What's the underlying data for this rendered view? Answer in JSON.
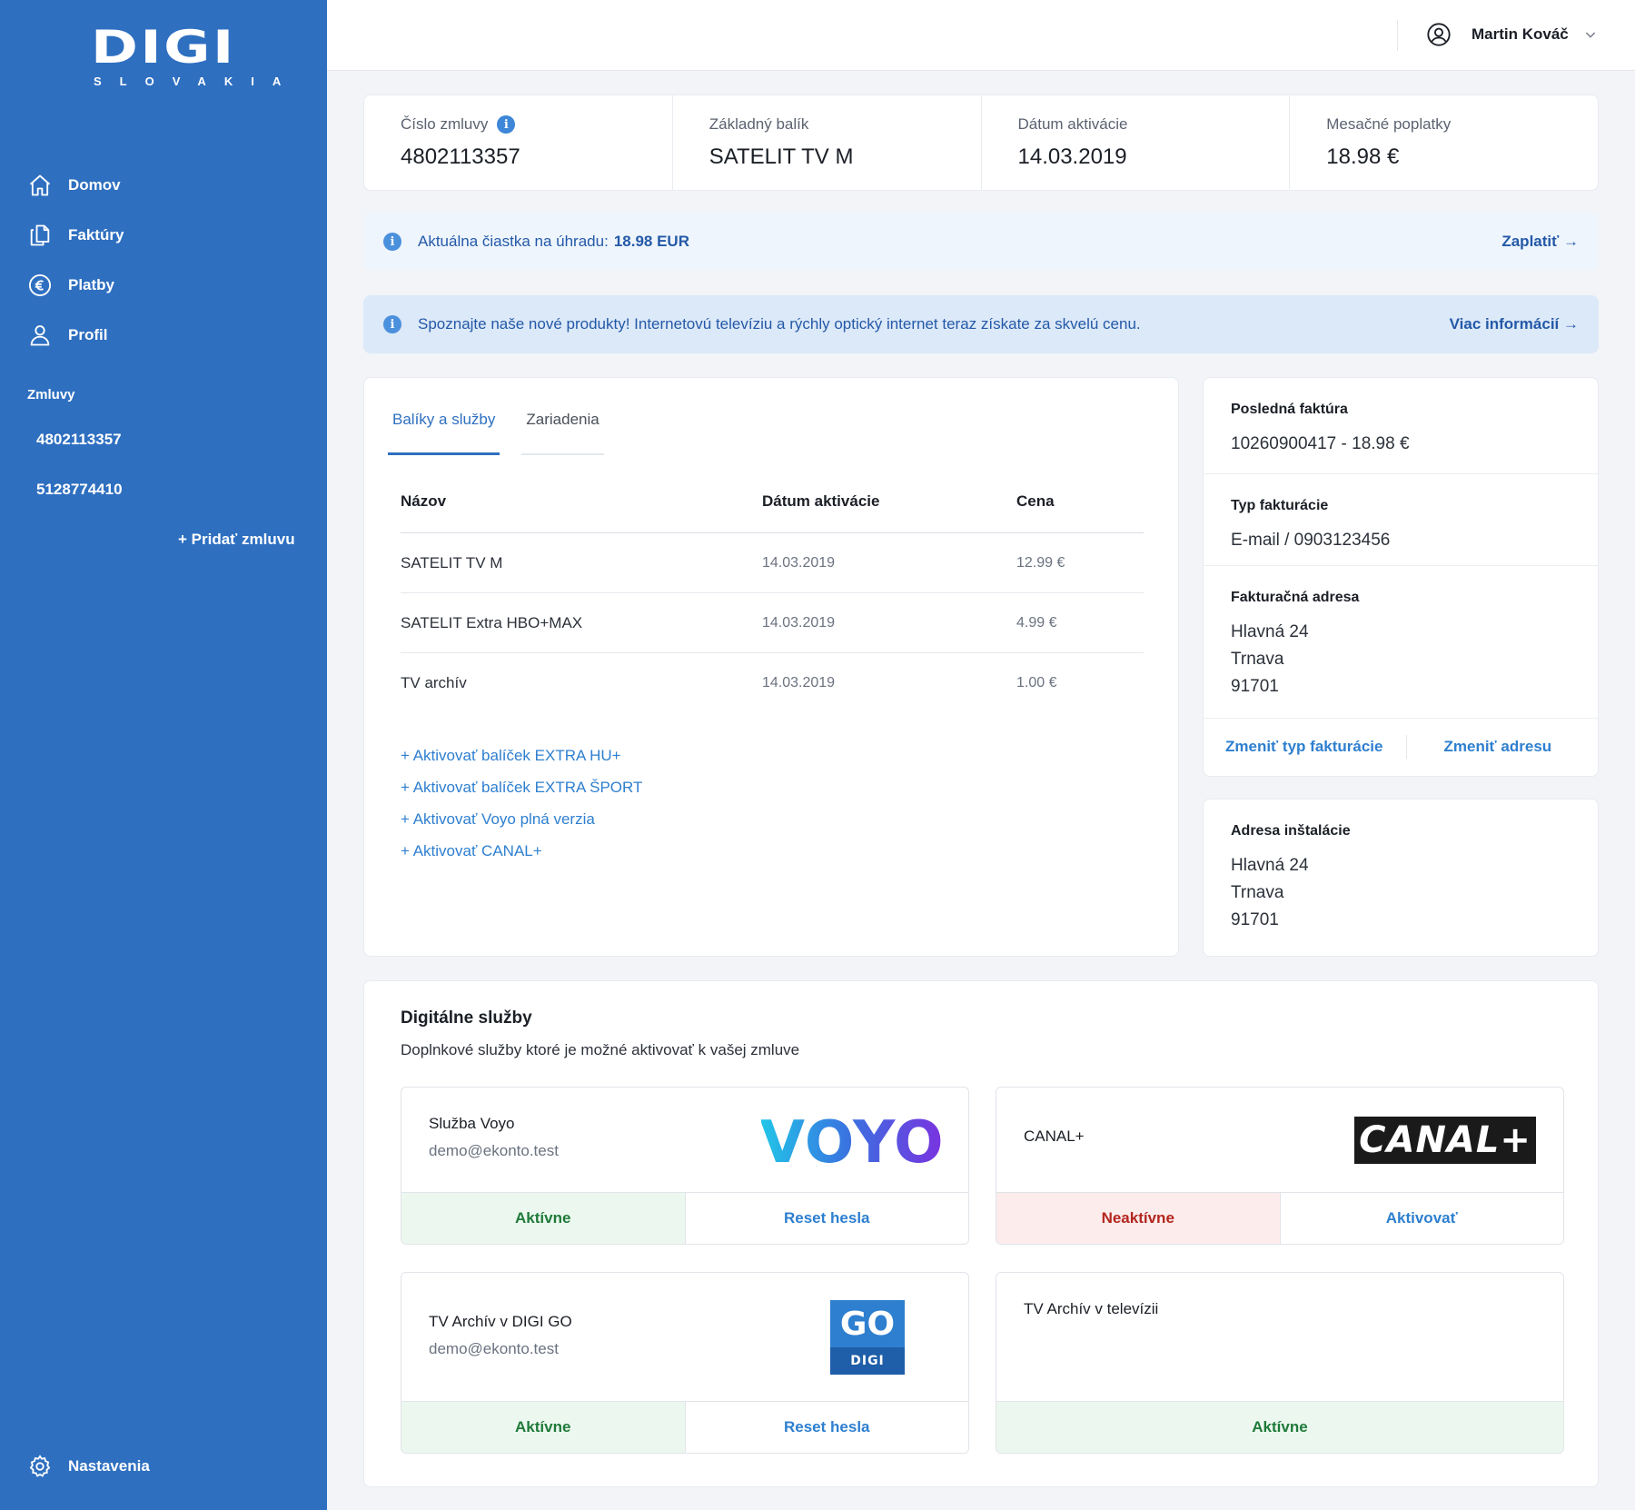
{
  "brand": {
    "logo_main": "DIGI",
    "logo_sub": "SLOVAKIA",
    "color": "#2e6fc0"
  },
  "sidebar": {
    "nav": [
      {
        "label": "Domov",
        "icon": "home-icon"
      },
      {
        "label": "Faktúry",
        "icon": "documents-icon"
      },
      {
        "label": "Platby",
        "icon": "euro-icon"
      },
      {
        "label": "Profil",
        "icon": "user-icon"
      }
    ],
    "contracts_label": "Zmluvy",
    "contracts": [
      "4802113357",
      "5128774410"
    ],
    "add_contract": "+ Pridať zmluvu",
    "settings": "Nastavenia"
  },
  "header": {
    "user_name": "Martin Kováč"
  },
  "summary": [
    {
      "label": "Číslo zmluvy",
      "value": "4802113357"
    },
    {
      "label": "Základný balík",
      "value": "SATELIT TV M"
    },
    {
      "label": "Dátum aktivácie",
      "value": "14.03.2019"
    },
    {
      "label": "Mesačné poplatky",
      "value": "18.98 €"
    }
  ],
  "alerts": {
    "payment_text": "Aktuálna čiastka na úhradu:",
    "payment_amount": "18.98 EUR",
    "payment_action": "Zaplatiť →",
    "promo_text": "Spoznajte naše nové produkty! Internetovú televíziu a rýchly optický internet teraz získate za skvelú cenu.",
    "promo_action": "Viac informácií →"
  },
  "services": {
    "tabs": [
      "Balíky a služby",
      "Zariadenia"
    ],
    "columns": [
      "Názov",
      "Dátum aktivácie",
      "Cena"
    ],
    "rows": [
      [
        "SATELIT TV M",
        "14.03.2019",
        "12.99 €"
      ],
      [
        "SATELIT Extra HBO+MAX",
        "14.03.2019",
        "4.99 €"
      ],
      [
        "TV archív",
        "14.03.2019",
        "1.00 €"
      ]
    ],
    "activate_links": [
      "+ Aktivovať balíček EXTRA HU+",
      "+ Aktivovať balíček EXTRA ŠPORT",
      "+ Aktivovať Voyo plná verzia",
      "+ Aktivovať CANAL+"
    ]
  },
  "billing": {
    "last_invoice_label": "Posledná faktúra",
    "last_invoice_value": "10260900417 - 18.98 €",
    "type_label": "Typ fakturácie",
    "type_value": "E-mail / 0903123456",
    "address_label": "Fakturačná adresa",
    "address_lines": [
      "Hlavná 24",
      "Trnava",
      "91701"
    ],
    "change_type": "Zmeniť typ fakturácie",
    "change_address": "Zmeniť adresu"
  },
  "install": {
    "label": "Adresa inštalácie",
    "lines": [
      "Hlavná 24",
      "Trnava",
      "91701"
    ]
  },
  "digital": {
    "title": "Digitálne služby",
    "subtitle": "Doplnkové služby ktoré je možné aktivovať k vašej zmluve",
    "cards": [
      {
        "name": "Služba Voyo",
        "email": "demo@ekonto.test",
        "logo": "VOYO",
        "status": "Aktívne",
        "action": "Reset hesla"
      },
      {
        "name": "CANAL+",
        "email": "",
        "logo": "CANAL+",
        "status": "Neaktívne",
        "action": "Aktivovať"
      },
      {
        "name": "TV Archív v DIGI GO",
        "email": "demo@ekonto.test",
        "logo_top": "GO",
        "logo_bottom": "DIGI",
        "status": "Aktívne",
        "action": "Reset hesla"
      },
      {
        "name": "TV Archív v televízii",
        "email": "",
        "status": "Aktívne"
      }
    ]
  }
}
